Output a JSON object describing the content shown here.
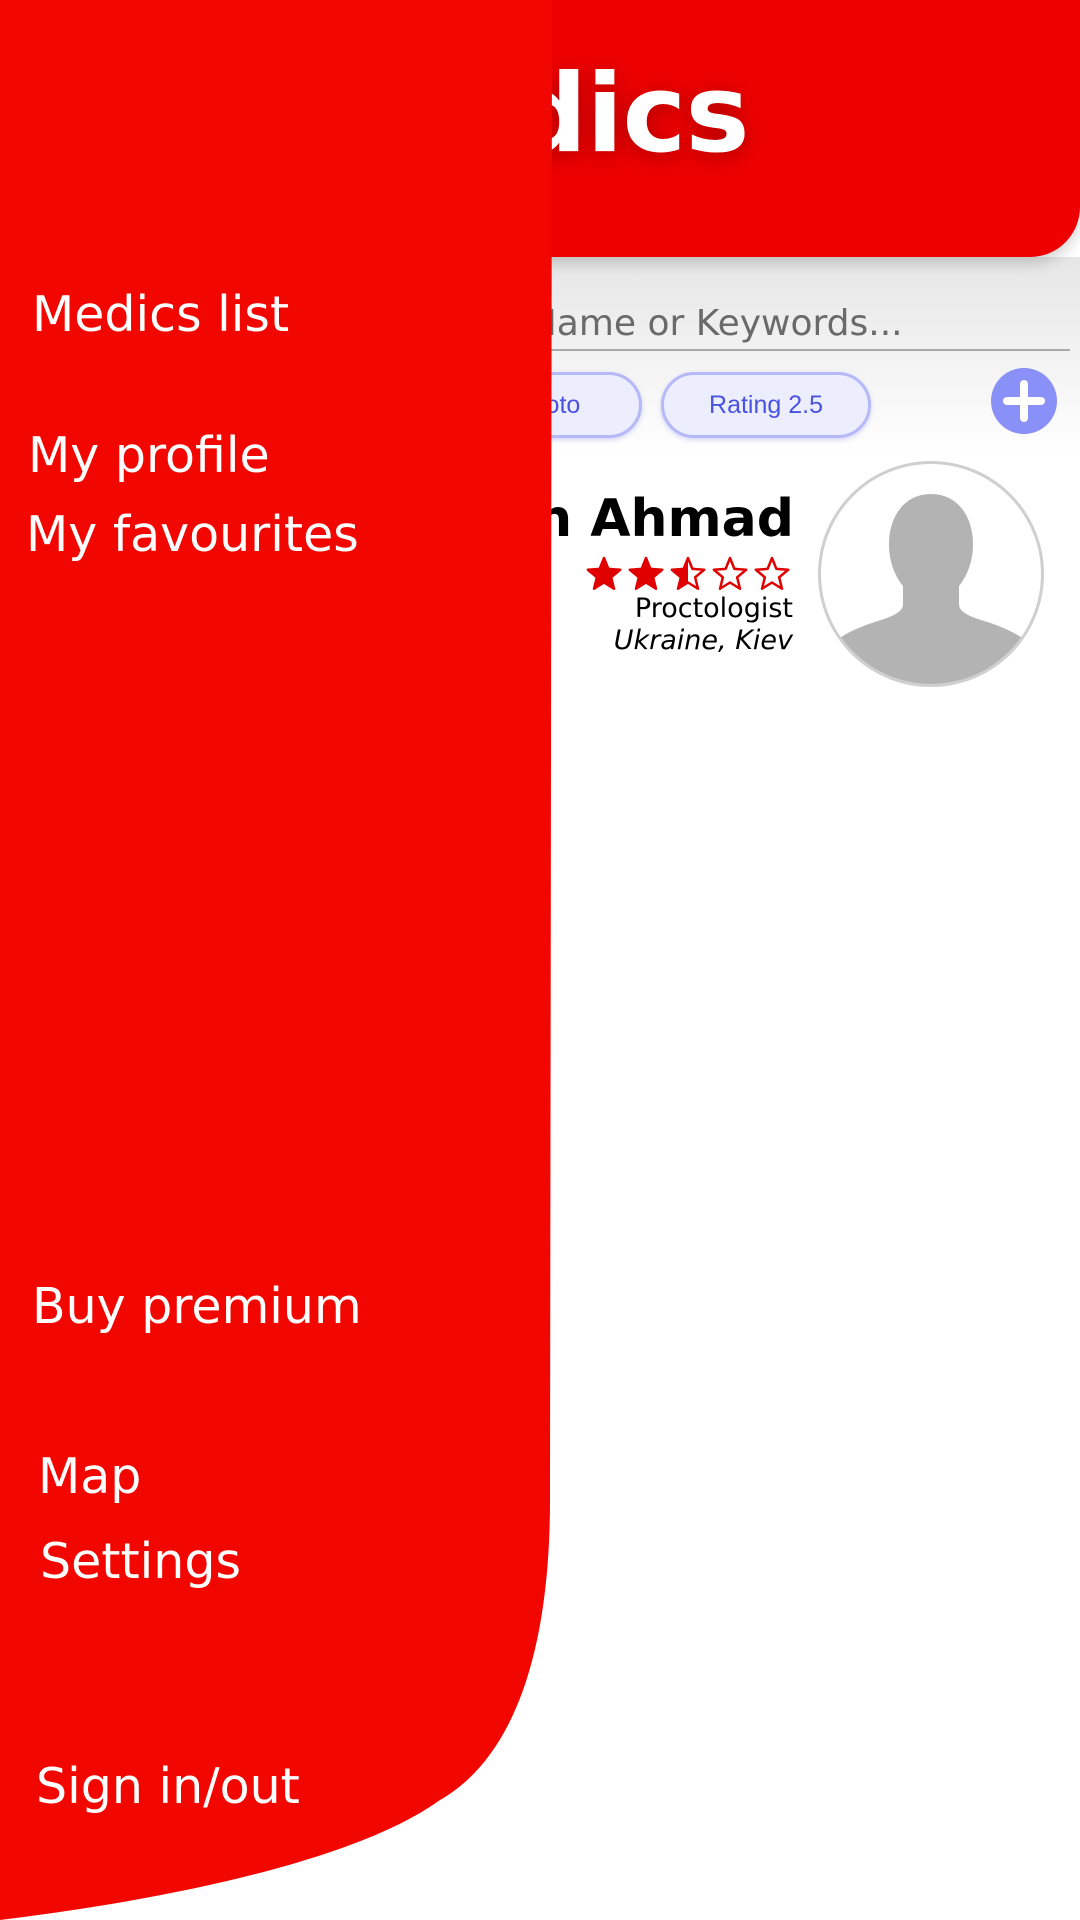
{
  "header": {
    "title": "Medics",
    "menu_icon": "hamburger-menu-icon"
  },
  "drawer": {
    "background_color": "#f20600",
    "items": [
      {
        "label": "Medics list"
      },
      {
        "label": "My profile"
      },
      {
        "label": "My favourites"
      },
      {
        "label": "Buy premium"
      },
      {
        "label": "Map"
      },
      {
        "label": "Settings"
      },
      {
        "label": "Sign in/out"
      }
    ]
  },
  "search": {
    "placeholder": "n by Name or Keywords..."
  },
  "filters": {
    "chips": [
      {
        "label": "hoto"
      },
      {
        "label": "Rating 2.5"
      }
    ],
    "add_icon": "plus-icon"
  },
  "medic": {
    "name": "n Ahmad",
    "rating": 2.5,
    "rating_max": 5,
    "specialty": "Proctologist",
    "location": "Ukraine, Kiev",
    "avatar_icon": "person-silhouette-icon"
  },
  "colors": {
    "header": "#ee0000",
    "accent": "#8990f7",
    "star": "#e00000"
  }
}
